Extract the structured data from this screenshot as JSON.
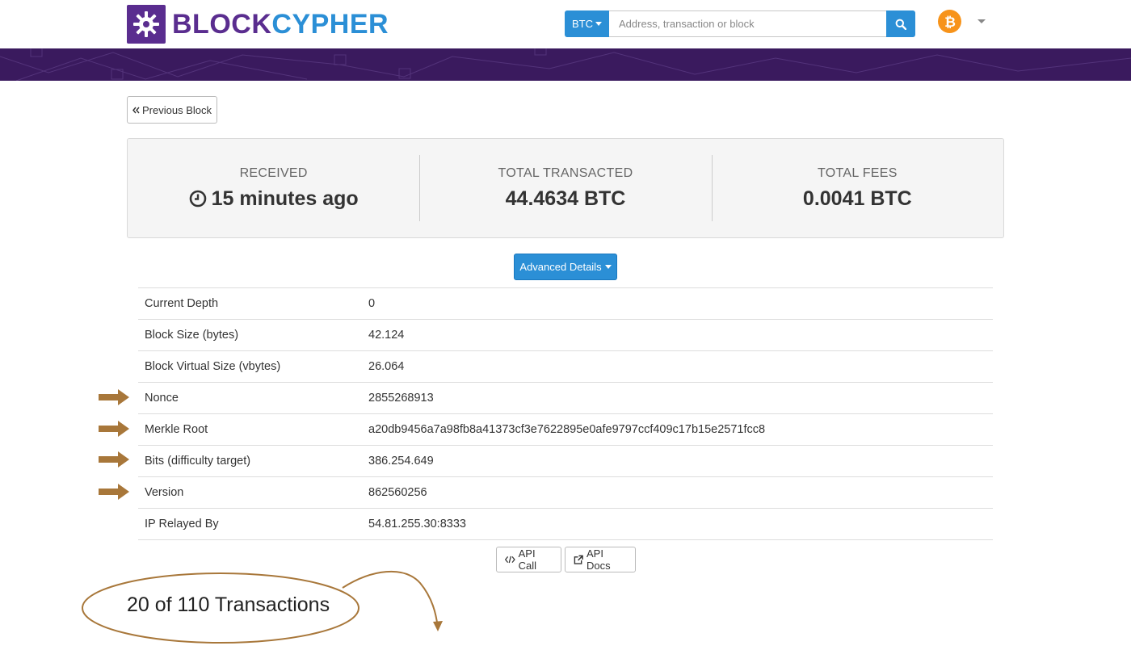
{
  "header": {
    "logo_part1": "BLOCK",
    "logo_part2": "CYPHER",
    "coin_selector": "BTC",
    "search_placeholder": "Address, transaction or block"
  },
  "nav": {
    "prev_block_label": "Previous Block"
  },
  "stats": {
    "received_label": "RECEIVED",
    "received_value": "15 minutes ago",
    "total_transacted_label": "TOTAL TRANSACTED",
    "total_transacted_value": "44.4634 BTC",
    "total_fees_label": "TOTAL FEES",
    "total_fees_value": "0.0041 BTC"
  },
  "advanced_details_label": "Advanced Details",
  "details": [
    {
      "key": "Current Depth",
      "value": "0",
      "highlighted": false
    },
    {
      "key": "Block Size (bytes)",
      "value": "42.124",
      "highlighted": false
    },
    {
      "key": "Block Virtual Size (vbytes)",
      "value": "26.064",
      "highlighted": false
    },
    {
      "key": "Nonce",
      "value": "2855268913",
      "highlighted": true
    },
    {
      "key": "Merkle Root",
      "value": "a20db9456a7a98fb8a41373cf3e7622895e0afe9797ccf409c17b15e2571fcc8",
      "highlighted": true
    },
    {
      "key": "Bits (difficulty target)",
      "value": "386.254.649",
      "highlighted": true
    },
    {
      "key": "Version",
      "value": "862560256",
      "highlighted": true
    },
    {
      "key": "IP Relayed By",
      "value": "54.81.255.30:8333",
      "highlighted": false
    }
  ],
  "api": {
    "call_label": "API Call",
    "docs_label": "API Docs"
  },
  "transactions_summary": "20 of 110 Transactions",
  "colors": {
    "brand_purple": "#5a2d8f",
    "brand_blue": "#2b8fd6",
    "banner": "#3a1a5e",
    "annotation": "#a8773a",
    "bitcoin": "#f7931a"
  }
}
